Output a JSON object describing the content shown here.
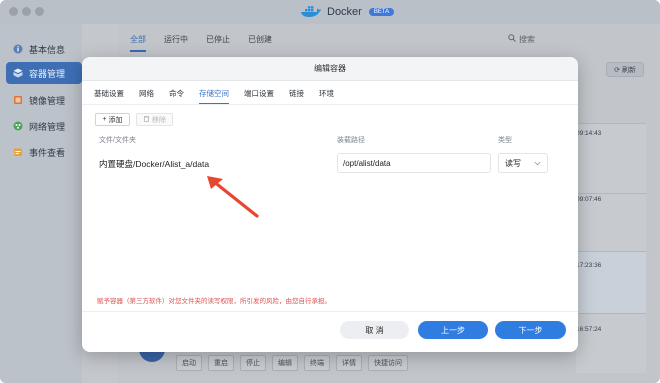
{
  "app": {
    "name": "Docker",
    "badge": "BETA"
  },
  "sidebar": {
    "items": [
      {
        "label": "基本信息",
        "icon": "info-icon"
      },
      {
        "label": "容器管理",
        "icon": "container-icon",
        "active": true
      },
      {
        "label": "镜像管理",
        "icon": "image-icon"
      },
      {
        "label": "网络管理",
        "icon": "network-icon"
      },
      {
        "label": "事件查看",
        "icon": "event-icon"
      }
    ]
  },
  "background": {
    "status_tabs": [
      "全部",
      "运行中",
      "已停止",
      "已创建"
    ],
    "search_placeholder": "搜索",
    "refresh_label": "刷新",
    "times": [
      "09:14:43",
      "09:07:46",
      "17:23:36",
      "16:57:24"
    ],
    "actions": [
      "启动",
      "重启",
      "停止",
      "编辑",
      "终端",
      "详情",
      "快捷访问"
    ]
  },
  "modal": {
    "title": "编辑容器",
    "tabs": [
      "基础设置",
      "网络",
      "命令",
      "存储空间",
      "端口设置",
      "链接",
      "环境"
    ],
    "active_tab": "存储空间",
    "add_label": "添加",
    "remove_label": "移除",
    "columns": {
      "folder": "文件/文件夹",
      "mount": "装载路径",
      "type": "类型"
    },
    "row": {
      "folder": "内置硬盘/Docker/Alist_a/data",
      "mount": "/opt/alist/data",
      "type": "读写"
    },
    "warning": "赋予容器（第三方软件）对您文件夹的读写权限，所引发的风险，由您自行承担。",
    "cancel_label": "取 消",
    "prev_label": "上一步",
    "next_label": "下一步"
  },
  "colors": {
    "accent": "#2f7de0",
    "warning": "#d9534f",
    "arrow": "#e8472f"
  }
}
